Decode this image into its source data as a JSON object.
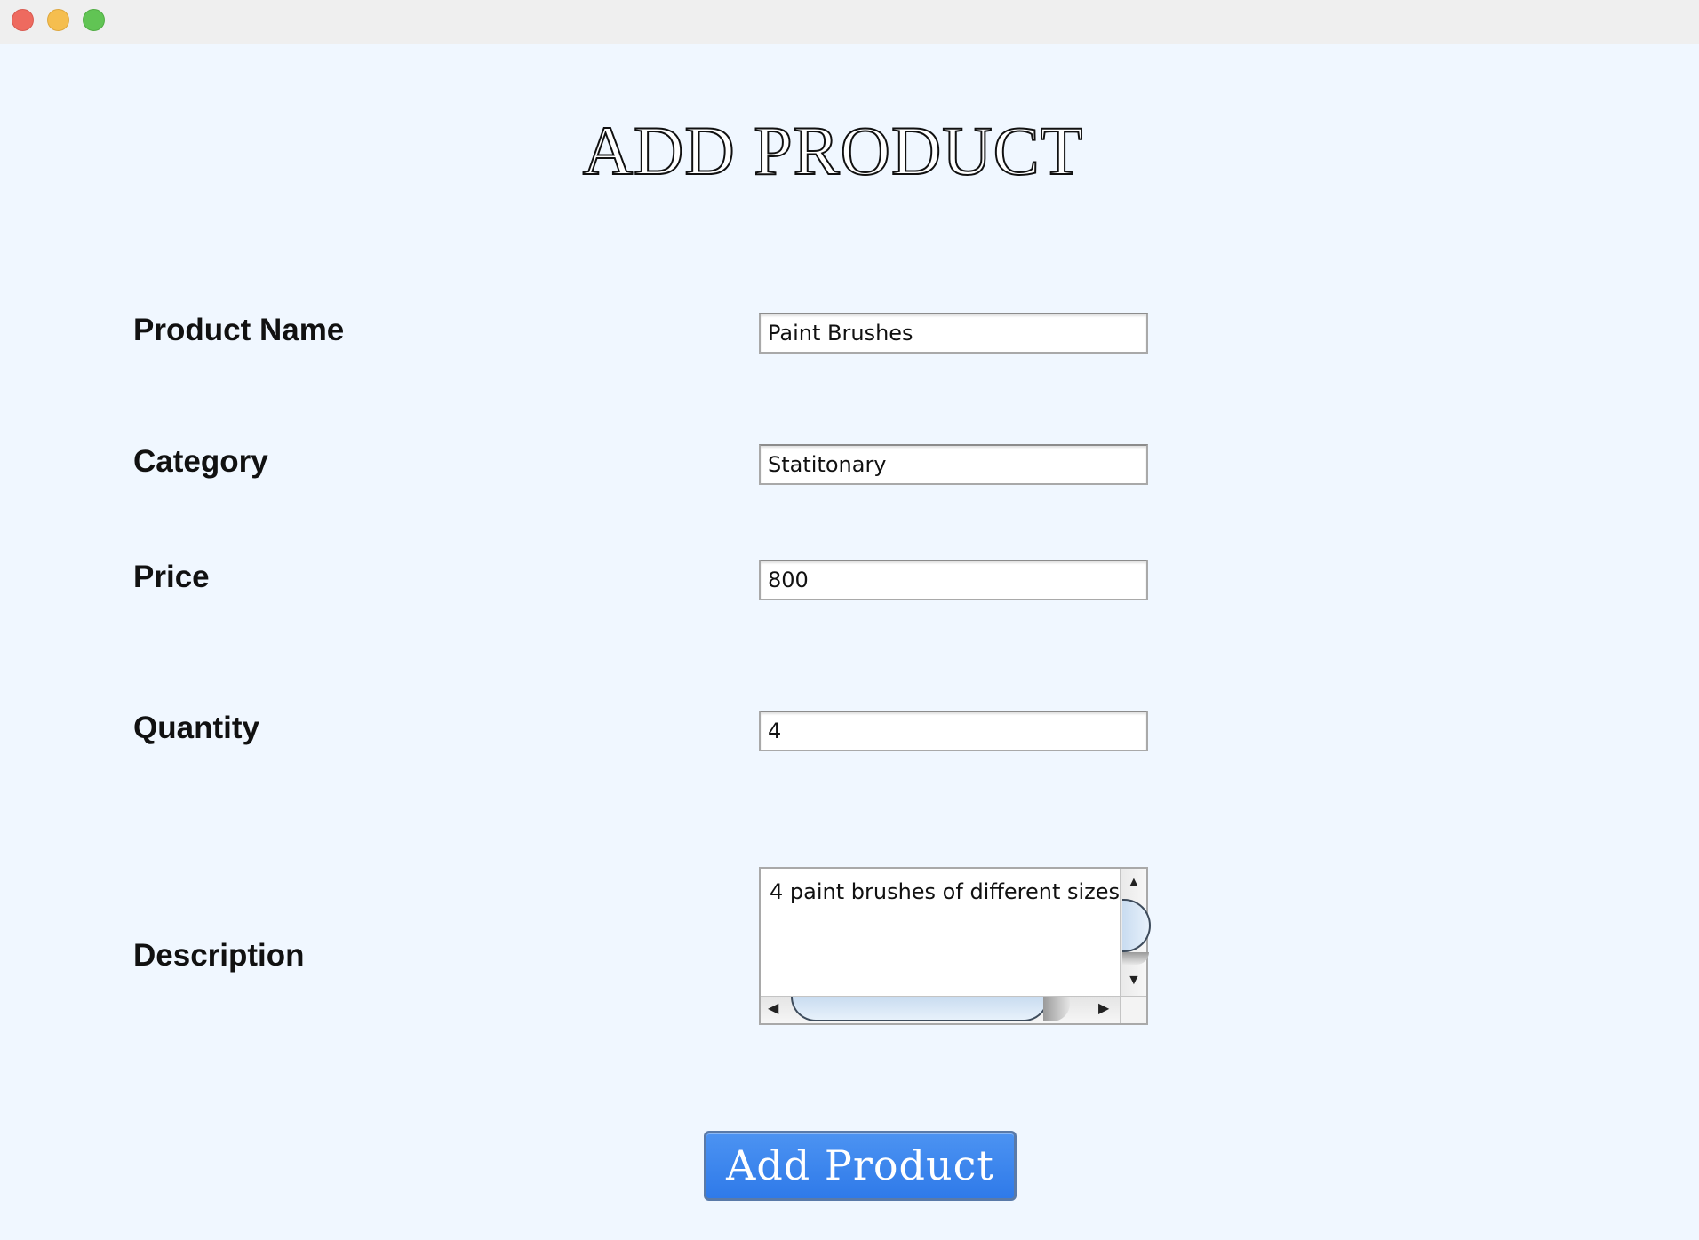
{
  "window": {
    "controls": [
      "close",
      "minimize",
      "maximize"
    ],
    "control_colors": {
      "close": "#ee6a5f",
      "minimize": "#f5be4f",
      "maximize": "#61c454"
    }
  },
  "form": {
    "title": "ADD PRODUCT",
    "fields": {
      "product_name": {
        "label": "Product Name",
        "value": "Paint Brushes"
      },
      "category": {
        "label": "Category",
        "value": "Statitonary"
      },
      "price": {
        "label": "Price",
        "value": "800"
      },
      "quantity": {
        "label": "Quantity",
        "value": "4"
      },
      "description": {
        "label": "Description",
        "value": "4 paint brushes of different sizes"
      }
    },
    "submit_label": "Add Product"
  },
  "colors": {
    "background": "#f0f7ff",
    "button": "#3a84ee"
  }
}
